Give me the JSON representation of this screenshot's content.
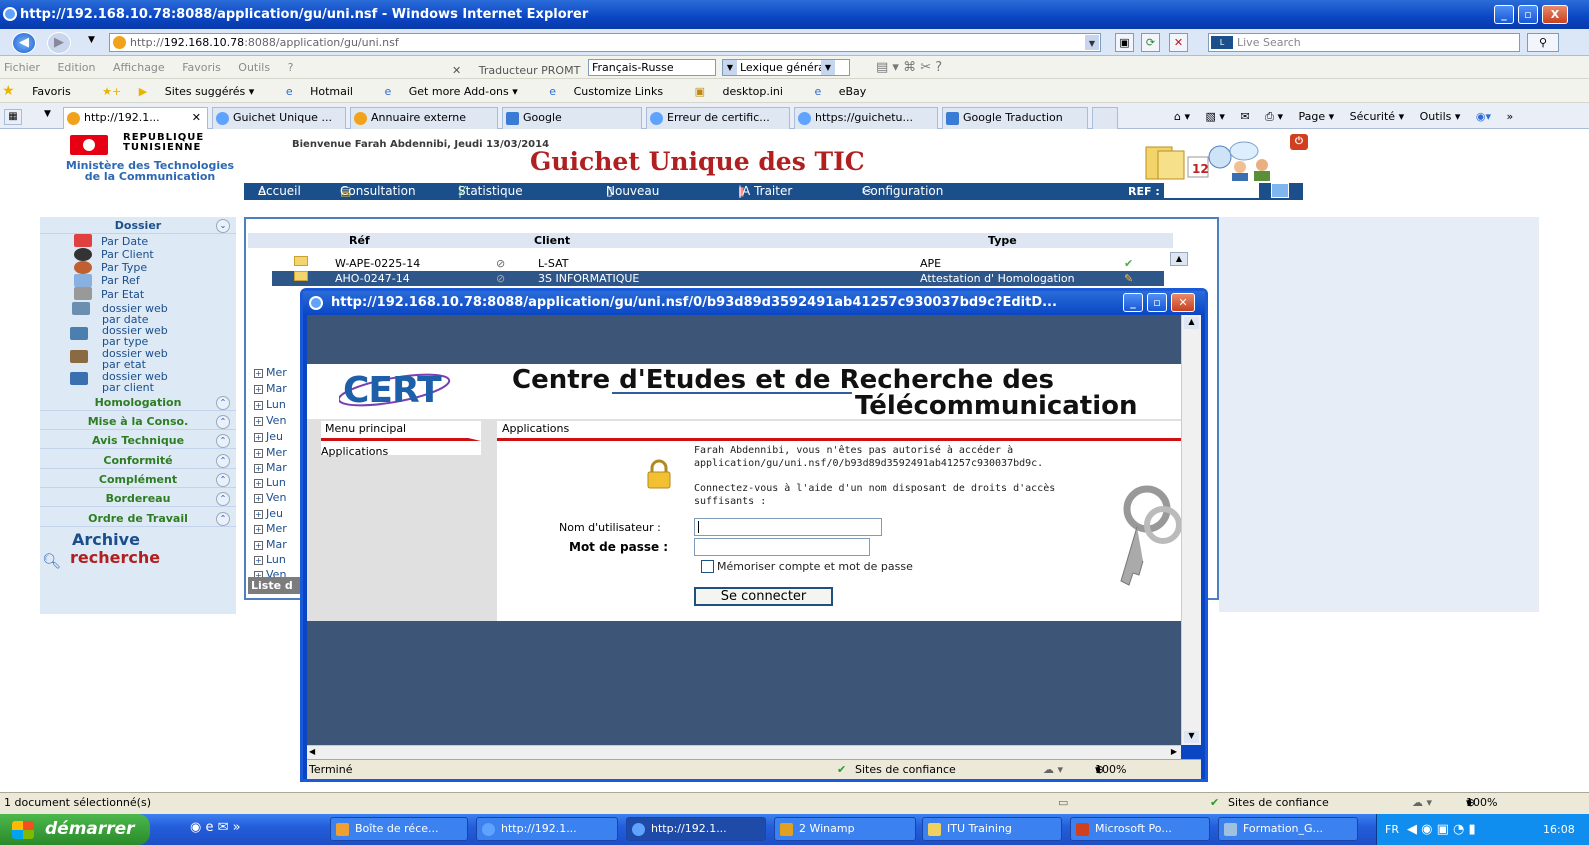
{
  "window": {
    "title": "http://192.168.10.78:8088/application/gu/uni.nsf - Windows Internet Explorer",
    "min": "_",
    "max": "▫",
    "close": "X"
  },
  "address": {
    "url_prefix": "http://",
    "url_host": "192.168.10.78",
    "url_rest": ":8088/application/gu/uni.nsf",
    "live_search_placeholder": "Live Search"
  },
  "menubar": {
    "items": [
      "Fichier",
      "Edition",
      "Affichage",
      "Favoris",
      "Outils",
      "?"
    ],
    "translator_label": "Traducteur PROMT",
    "lang_pair": "Français-Russe",
    "dictionary": "Lexique général"
  },
  "favbar": {
    "favorites": "Favoris",
    "suggested": "Sites suggérés ▾",
    "links": [
      "Hotmail",
      "Get more Add-ons ▾",
      "Customize Links",
      "desktop.ini",
      "eBay"
    ]
  },
  "tabs": [
    {
      "label": "http://192.1..."
    },
    {
      "label": "Guichet Unique ..."
    },
    {
      "label": "Annuaire externe"
    },
    {
      "label": "Google"
    },
    {
      "label": "Erreur de certific..."
    },
    {
      "label": "https://guichetu..."
    },
    {
      "label": "Google Traduction"
    }
  ],
  "commandbar": {
    "page": "Page ▾",
    "security": "Sécurité ▾",
    "tools": "Outils ▾"
  },
  "header": {
    "republic_line1": "REPUBLIQUE",
    "republic_line2": "TUNISIENNE",
    "ministry_line1": "Ministère des Technologies",
    "ministry_line2": "de la Communication",
    "welcome": "Bienvenue Farah Abdennibi, Jeudi 13/03/2014",
    "title": "Guichet Unique des TIC",
    "calendar_day": "12"
  },
  "nav": {
    "accueil": "Accueil",
    "consultation": "Consultation",
    "statistique": "Statistique",
    "nouveau": "Nouveau",
    "a_traiter": "|A Traiter",
    "configuration": "Configuration",
    "ref_label": "REF :"
  },
  "sidebar": {
    "dossier": "Dossier",
    "items": [
      "Par Date",
      "Par Client",
      "Par Type",
      "Par Ref",
      "Par Etat"
    ],
    "web_items": [
      {
        "l1": "dossier web",
        "l2": "par date"
      },
      {
        "l1": "dossier web",
        "l2": "par type"
      },
      {
        "l1": "dossier web",
        "l2": "par etat"
      },
      {
        "l1": "dossier web",
        "l2": "par client"
      }
    ],
    "categories": [
      "Homologation",
      "Mise à la Conso.",
      "Avis Technique",
      "Conformité",
      "Complément",
      "Bordereau",
      "Ordre de Travail"
    ],
    "archive": "Archive",
    "recherche": "recherche"
  },
  "table": {
    "headers": {
      "ref": "Réf",
      "client": "Client",
      "type": "Type"
    },
    "rows": [
      {
        "ref": "W-APE-0225-14",
        "client": "L-SAT",
        "type": "APE"
      },
      {
        "ref": "AHO-0247-14",
        "client": "3S INFORMATIQUE",
        "type": "Attestation d' Homologation"
      }
    ],
    "expand_items": [
      "Mer",
      "Mar",
      "Lun",
      "Ven",
      "Jeu",
      "Mer",
      "Mar",
      "Lun",
      "Ven",
      "Jeu",
      "Mer",
      "Mar",
      "Lun",
      "Ven"
    ],
    "footer": "Liste d"
  },
  "popup": {
    "title": "http://192.168.10.78:8088/application/gu/uni.nsf/0/b93d89d3592491ab41257c930037bd9c?EditD...",
    "cert_logo": "CERT",
    "cert_name1": "Centre d'Etudes et de Recherche des",
    "cert_name2": "Télécommunication",
    "menu_title": "Menu principal",
    "menu_item": "Applications",
    "app_title": "Applications",
    "msg_line1": "Farah Abdennibi, vous n'êtes pas autorisé à accéder à",
    "msg_line2": "application/gu/uni.nsf/0/b93d89d3592491ab41257c930037bd9c.",
    "msg_line3": "Connectez-vous à l'aide d'un nom disposant de droits d'accès",
    "msg_line4": "suffisants :",
    "username_label": "Nom d'utilisateur :",
    "username_value": "",
    "password_label": "Mot de passe :",
    "remember_label": "Mémoriser compte et mot de passe",
    "connect_button": "Se connecter",
    "status_done": "Terminé",
    "trusted_sites": "Sites de confiance",
    "zoom": "100%"
  },
  "statusbar": {
    "selected": "1 document sélectionné(s)",
    "trusted_sites": "Sites de confiance",
    "zoom": "100%"
  },
  "taskbar": {
    "start": "démarrer",
    "items": [
      "Boîte de réce...",
      "http://192.1...",
      "http://192.1...",
      "2 Winamp",
      "ITU Training",
      "Microsoft Po...",
      "Formation_G..."
    ],
    "lang": "FR",
    "clock": "16:08"
  },
  "colors": {
    "title_blue": "#0a46c4",
    "nav_blue": "#1b4f8c",
    "brand_red": "#b02020",
    "sidebar_green": "#2e7d22",
    "selected_row": "#2f5688",
    "cert_band": "#3d5677"
  }
}
